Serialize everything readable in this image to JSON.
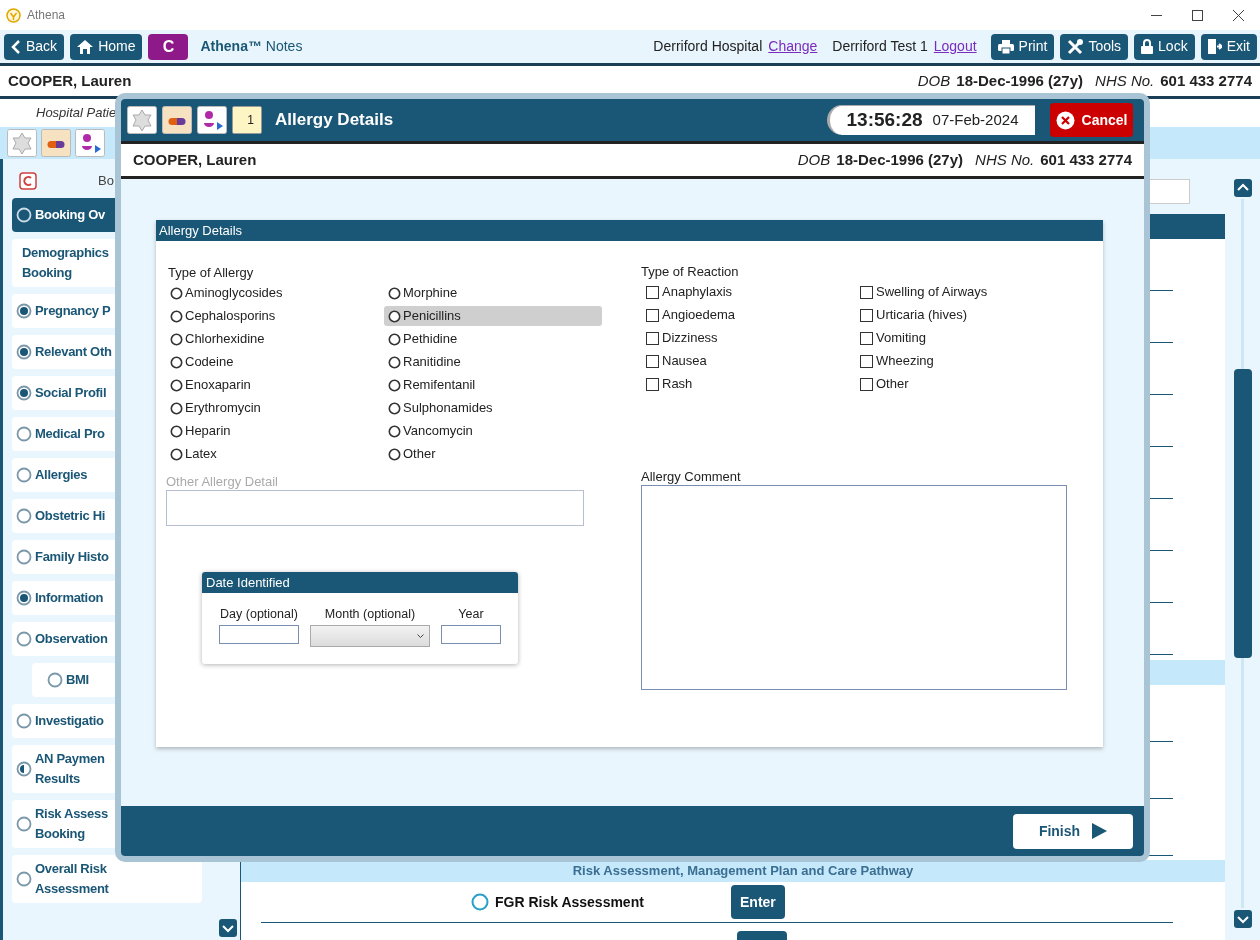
{
  "app": {
    "title": "Athena"
  },
  "toolbar": {
    "left_buttons": [
      {
        "label": "Back",
        "kind": "back"
      },
      {
        "label": "Home",
        "kind": "home"
      },
      {
        "label": "C",
        "kind": "badge"
      }
    ],
    "app_name": "**Athena™** Notes",
    "location": "Derriford Hospital",
    "location_link": "Change",
    "user": "Derriford Test 1",
    "user_link": "Logout",
    "right_buttons": [
      {
        "label": "Print",
        "kind": "print"
      },
      {
        "label": "Tools",
        "kind": "tools"
      },
      {
        "label": "Lock",
        "kind": "lock"
      },
      {
        "label": "Exit",
        "kind": "exit"
      }
    ]
  },
  "patient_banner": {
    "name": "COOPER, Lauren",
    "dob_label": "DOB",
    "dob": "18-Dec-1996 (27y)",
    "nhs_label": "NHS No.",
    "nhs": "601 433 2774"
  },
  "subheader": "Hospital Patie",
  "quick_icons": [
    {
      "kind": "allergy"
    },
    {
      "kind": "medication"
    },
    {
      "kind": "pregnancy"
    }
  ],
  "sidebar": {
    "heading": "Bo",
    "items": [
      {
        "label": "Booking Ov",
        "kind": "incomplete",
        "selected": true
      },
      {
        "label": "Demographics\nBooking",
        "kind": "plain",
        "selected": false
      },
      {
        "label": "Pregnancy P",
        "kind": "complete",
        "selected": false
      },
      {
        "label": "Relevant Oth",
        "kind": "complete",
        "selected": false
      },
      {
        "label": "Social Profil",
        "kind": "complete",
        "selected": false
      },
      {
        "label": "Medical Pro",
        "kind": "incomplete",
        "selected": false
      },
      {
        "label": "Allergies",
        "kind": "incomplete",
        "selected": false
      },
      {
        "label": "Obstetric Hi",
        "kind": "incomplete",
        "selected": false
      },
      {
        "label": "Family Histo",
        "kind": "incomplete",
        "selected": false
      },
      {
        "label": "Information",
        "kind": "complete",
        "selected": false
      },
      {
        "label": "Observation",
        "kind": "incomplete",
        "selected": false,
        "children": [
          {
            "label": "BMI",
            "kind": "incomplete",
            "selected": false
          }
        ]
      },
      {
        "label": "Investigatio",
        "kind": "incomplete",
        "selected": false
      },
      {
        "label": "AN Paymen\nResults",
        "kind": "partial",
        "selected": false
      },
      {
        "label": "Risk Assess\nBooking",
        "kind": "incomplete",
        "selected": false
      },
      {
        "label": "Overall Risk\nAssessment",
        "kind": "incomplete",
        "selected": false
      }
    ]
  },
  "main": {
    "section_header": "Risk Assessment, Management Plan and Care Pathway",
    "rows": [
      {
        "label": "FGR Risk Assessment",
        "checked": false,
        "button": "Enter"
      }
    ]
  },
  "modal": {
    "title": "Allergy Details",
    "icons": [
      {
        "kind": "allergy"
      },
      {
        "kind": "medication"
      },
      {
        "kind": "pregnancy"
      },
      {
        "kind": "calendar",
        "text": "1"
      }
    ],
    "time": "13:56:28",
    "date": "07-Feb-2024",
    "cancel": "Cancel",
    "patient": {
      "name": "COOPER, Lauren",
      "dob_label": "DOB",
      "dob": "18-Dec-1996 (27y)",
      "nhs_label": "NHS No.",
      "nhs": "601 433 2774"
    },
    "card_title": "Allergy Details",
    "allergy_label": "Type of Allergy",
    "allergies": [
      {
        "label": "Aminoglycosides",
        "selected": false,
        "focused": false
      },
      {
        "label": "Cephalosporins",
        "selected": false,
        "focused": false
      },
      {
        "label": "Chlorhexidine",
        "selected": false,
        "focused": false
      },
      {
        "label": "Codeine",
        "selected": false,
        "focused": false
      },
      {
        "label": "Enoxaparin",
        "selected": false,
        "focused": false
      },
      {
        "label": "Erythromycin",
        "selected": false,
        "focused": false
      },
      {
        "label": "Heparin",
        "selected": false,
        "focused": false
      },
      {
        "label": "Latex",
        "selected": false,
        "focused": false
      },
      {
        "label": "Morphine",
        "selected": false,
        "focused": false
      },
      {
        "label": "Penicillins",
        "selected": false,
        "focused": true
      },
      {
        "label": "Pethidine",
        "selected": false,
        "focused": false
      },
      {
        "label": "Ranitidine",
        "selected": false,
        "focused": false
      },
      {
        "label": "Remifentanil",
        "selected": false,
        "focused": false
      },
      {
        "label": "Sulphonamides",
        "selected": false,
        "focused": false
      },
      {
        "label": "Vancomycin",
        "selected": false,
        "focused": false
      },
      {
        "label": "Other",
        "selected": false,
        "focused": false
      }
    ],
    "reaction_label": "Type of Reaction",
    "reactions": [
      {
        "label": "Anaphylaxis",
        "checked": false
      },
      {
        "label": "Angioedema",
        "checked": false
      },
      {
        "label": "Dizziness",
        "checked": false
      },
      {
        "label": "Nausea",
        "checked": false
      },
      {
        "label": "Rash",
        "checked": false
      },
      {
        "label": "Swelling of Airways",
        "checked": false
      },
      {
        "label": "Urticaria (hives)",
        "checked": false
      },
      {
        "label": "Vomiting",
        "checked": false
      },
      {
        "label": "Wheezing",
        "checked": false
      },
      {
        "label": "Other",
        "checked": false
      }
    ],
    "other_detail_label": "Other Allergy Detail",
    "other_detail_disabled": true,
    "comment_label": "Allergy Comment",
    "date_card": {
      "title": "Date Identified",
      "day_label": "Day (optional)",
      "month_label": "Month (optional)",
      "year_label": "Year"
    },
    "finish": "Finish"
  }
}
